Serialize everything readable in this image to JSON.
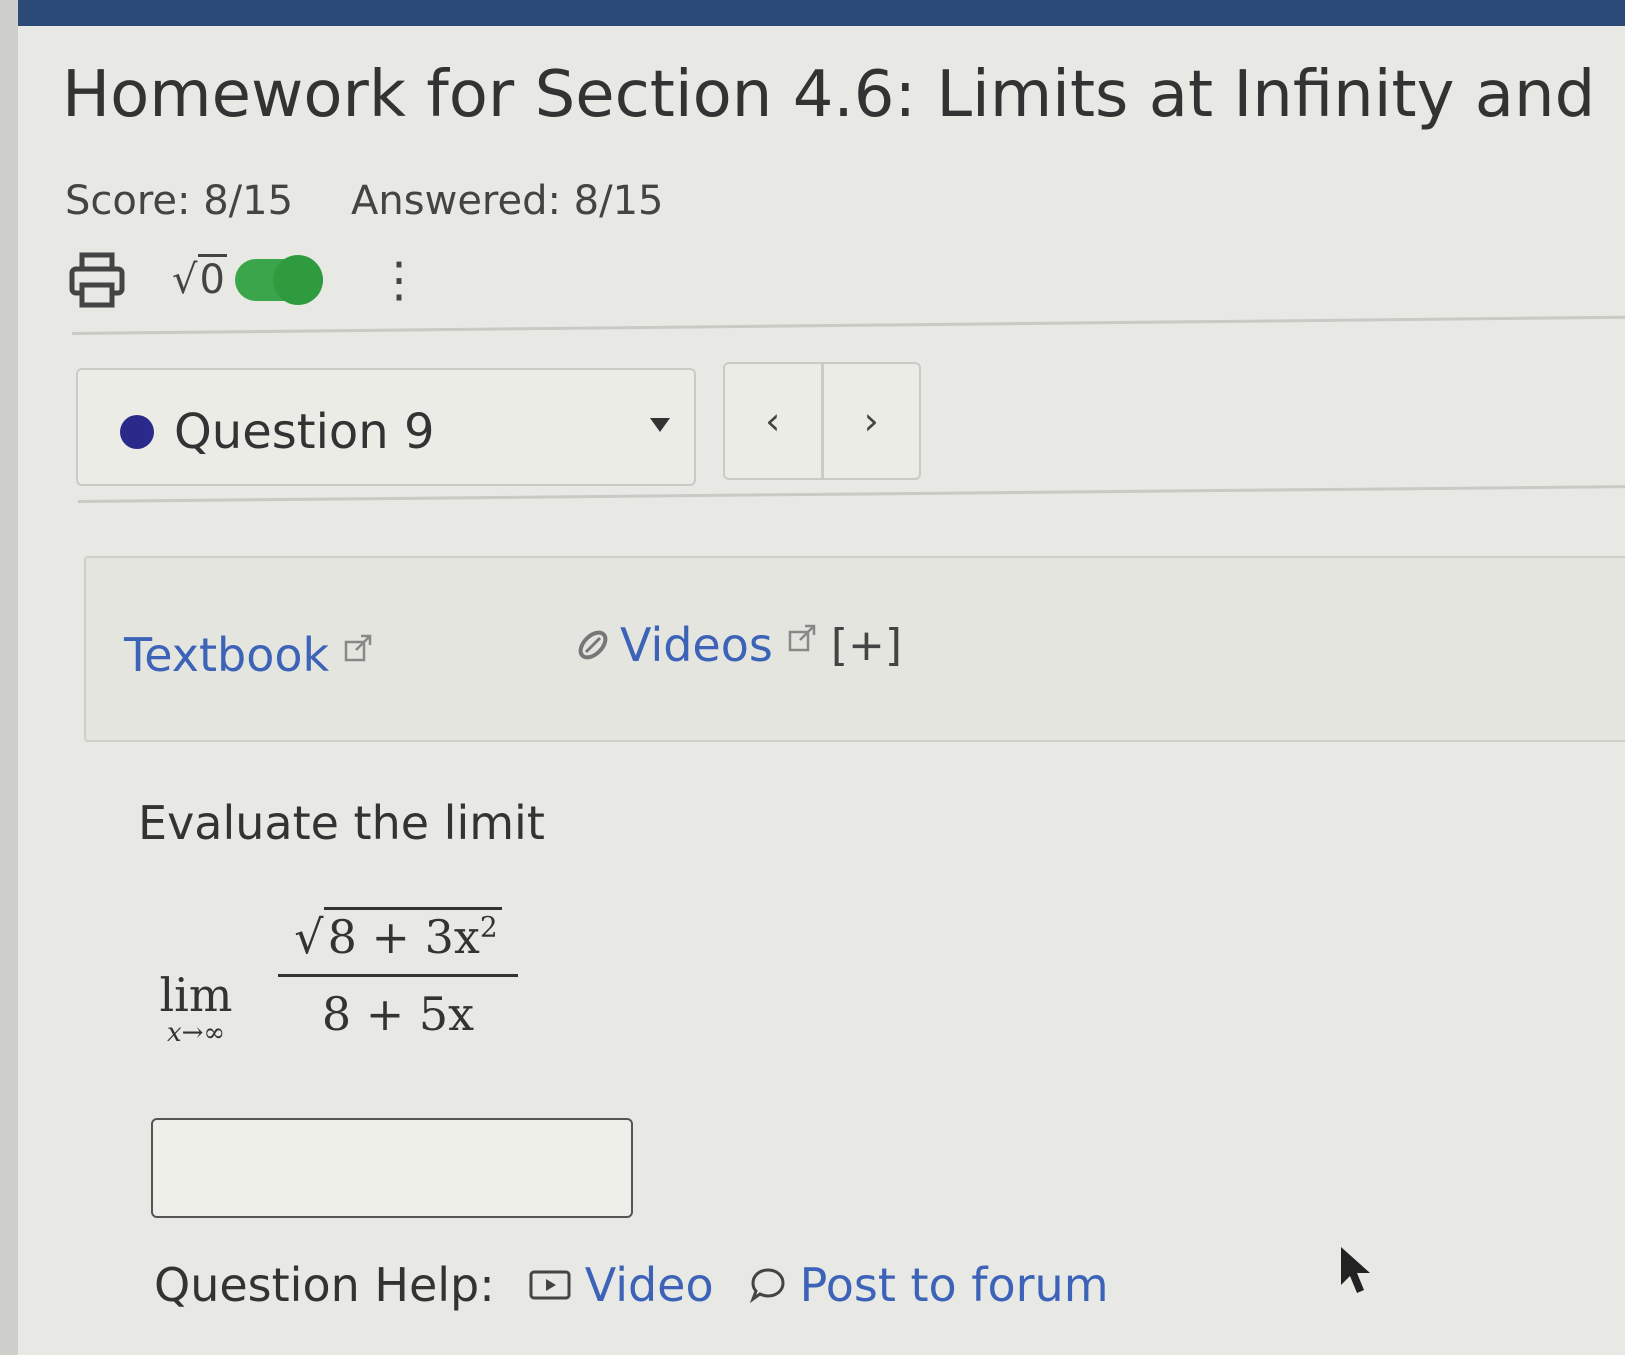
{
  "header": {
    "title": "Homework for Section 4.6: Limits at Infinity and",
    "score": "Score: 8/15",
    "answered": "Answered: 8/15"
  },
  "toolbar": {
    "icons": [
      "print-icon",
      "math-toggle",
      "kebab-menu-icon"
    ],
    "sqrt_symbol": "√",
    "sqrt_radicand": "0",
    "toggle_state": "on",
    "kebab": "⋮"
  },
  "question_nav": {
    "selected": "Question 9",
    "prev": "‹",
    "next": "›"
  },
  "resources": {
    "textbook": "Textbook",
    "videos": "Videos",
    "expand": "[+]"
  },
  "question": {
    "prompt": "Evaluate the limit",
    "lim": "lim",
    "lim_sub": "x→∞",
    "numerator_radicand": "8 + 3x",
    "numerator_exp": "2",
    "denominator": "8 + 5x",
    "answer_value": ""
  },
  "help": {
    "label": "Question Help:",
    "video": "Video",
    "forum": "Post to forum"
  },
  "colors": {
    "link": "#3c63b8",
    "toggle": "#3aa54a",
    "question_dot": "#2a2a8a",
    "top_bar": "#2c4a78"
  }
}
